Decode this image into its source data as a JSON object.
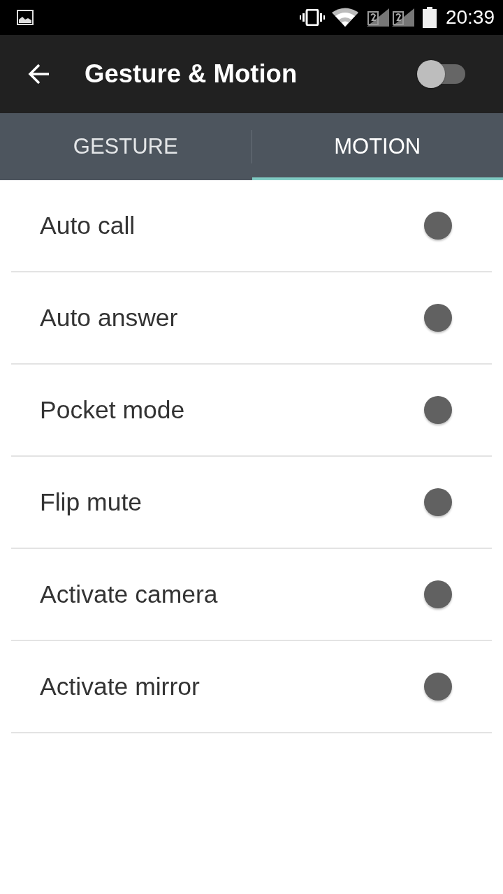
{
  "status_bar": {
    "time": "20:39"
  },
  "app_bar": {
    "title": "Gesture & Motion",
    "master_switch": {
      "on": false
    }
  },
  "tabs": [
    {
      "label": "GESTURE",
      "selected": false
    },
    {
      "label": "MOTION",
      "selected": true
    }
  ],
  "settings": [
    {
      "label": "Auto call",
      "on": false,
      "disabled": true
    },
    {
      "label": "Auto answer",
      "on": false,
      "disabled": true
    },
    {
      "label": "Pocket mode",
      "on": false,
      "disabled": true
    },
    {
      "label": "Flip mute",
      "on": false,
      "disabled": true
    },
    {
      "label": "Activate camera",
      "on": false,
      "disabled": true
    },
    {
      "label": "Activate mirror",
      "on": false,
      "disabled": true
    }
  ]
}
